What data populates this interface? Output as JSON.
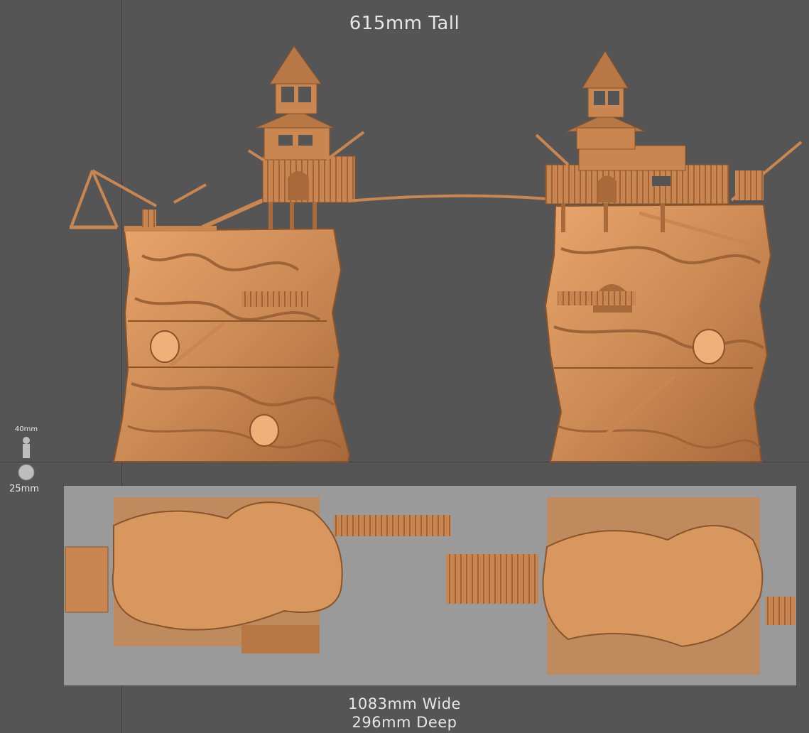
{
  "title": "615mm Tall",
  "scale_figures": {
    "figure_label": "40mm",
    "base_label": "25mm"
  },
  "dimensions": {
    "width": "1083mm Wide",
    "depth": "296mm Deep"
  },
  "colors": {
    "background": "#555555",
    "model": "#d28f5a",
    "model_shadow": "#9e6336",
    "model_highlight": "#f0b07a",
    "top_panel": "#9a9a9a",
    "guide_line": "#3f3f3f"
  }
}
